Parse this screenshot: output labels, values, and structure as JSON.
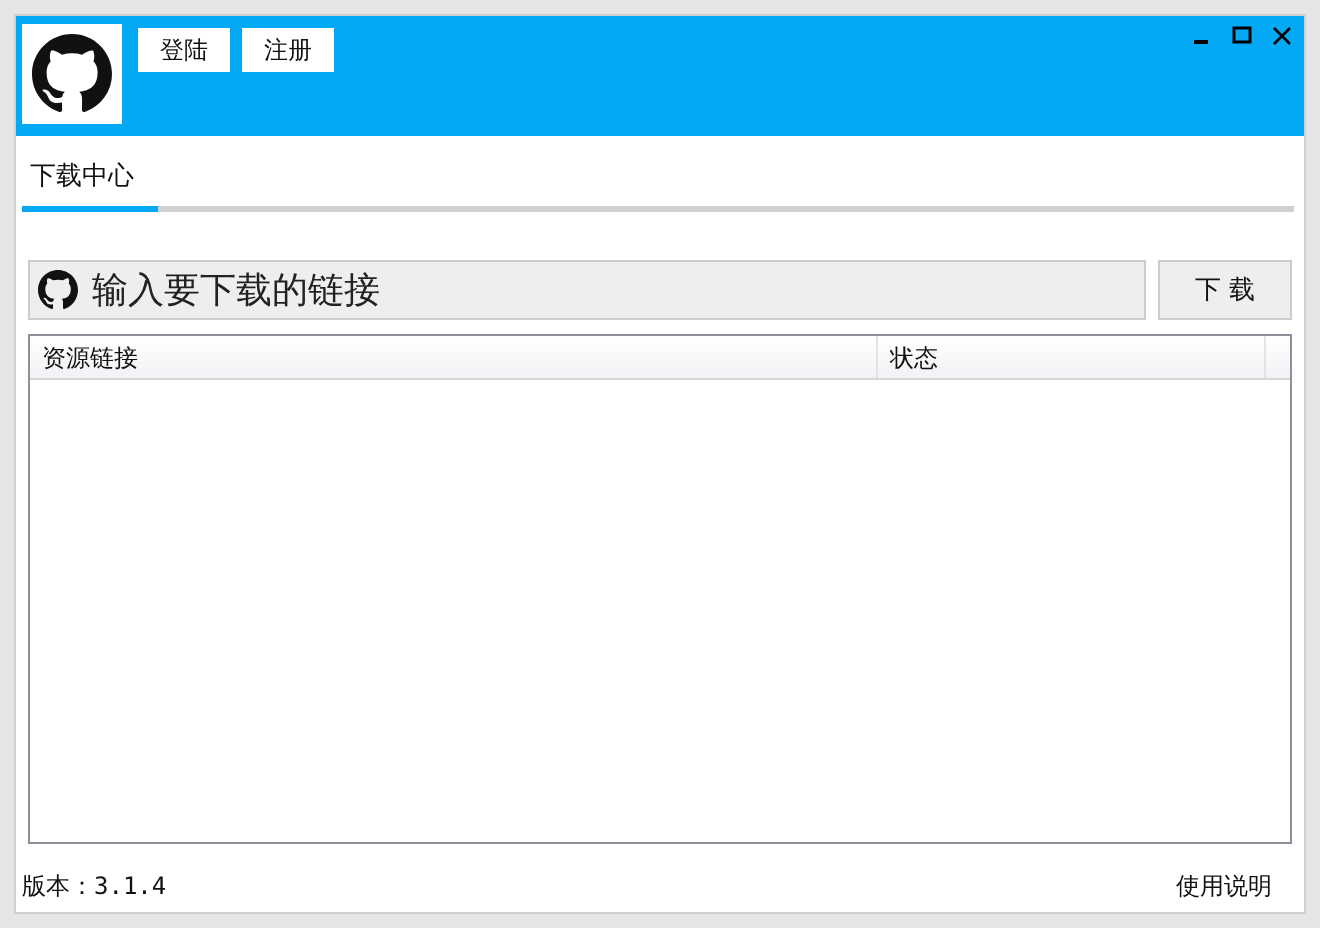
{
  "header": {
    "buttons": [
      "登陆",
      "注册"
    ]
  },
  "tabs": [
    {
      "label": "下载中心",
      "selected": true
    }
  ],
  "url_field": {
    "placeholder": "输入要下载的链接"
  },
  "download_button": "下 载",
  "table": {
    "columns": [
      "资源链接",
      "状态"
    ]
  },
  "status_bar": {
    "version": "版本：3.1.4",
    "help_link": "使用说明"
  }
}
